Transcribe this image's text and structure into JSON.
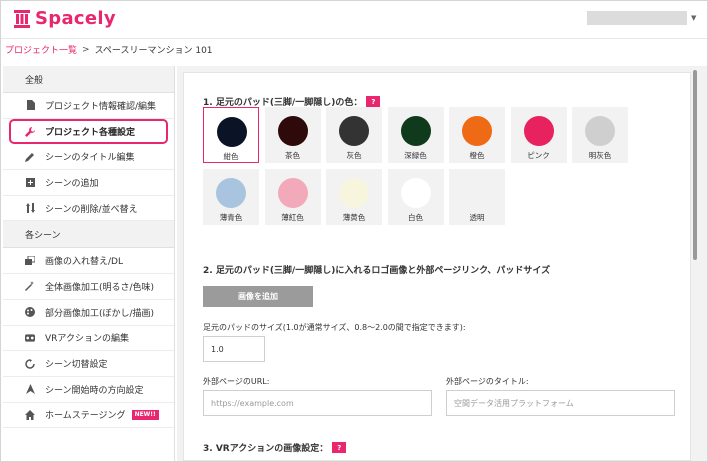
{
  "brand": {
    "name": "Spacely",
    "accent": "#e8276f"
  },
  "breadcrumb": {
    "link": "プロジェクト一覧",
    "separator": ">",
    "current": "スペースリーマンション 101"
  },
  "sidebar": {
    "section_general": "全般",
    "general_items": [
      {
        "label": "プロジェクト情報確認/編集",
        "icon": "document-icon"
      },
      {
        "label": "プロジェクト各種設定",
        "icon": "wrench-icon",
        "active": true
      },
      {
        "label": "シーンのタイトル編集",
        "icon": "pencil-icon"
      },
      {
        "label": "シーンの追加",
        "icon": "plus-square-icon"
      },
      {
        "label": "シーンの削除/並べ替え",
        "icon": "sort-icon"
      }
    ],
    "section_scenes": "各シーン",
    "scene_items": [
      {
        "label": "画像の入れ替え/DL",
        "icon": "image-swap-icon"
      },
      {
        "label": "全体画像加工(明るさ/色味)",
        "icon": "magic-wand-icon"
      },
      {
        "label": "部分画像加工(ぼかし/描画)",
        "icon": "palette-icon"
      },
      {
        "label": "VRアクションの編集",
        "icon": "vr-icon"
      },
      {
        "label": "シーン切替設定",
        "icon": "refresh-icon"
      },
      {
        "label": "シーン開始時の方向設定",
        "icon": "direction-icon"
      },
      {
        "label": "ホームステージング",
        "icon": "home-icon",
        "badge": "NEW!!"
      }
    ]
  },
  "section1": {
    "title": "1. 足元のパッド(三脚/一脚隠し)の色：",
    "help": "?",
    "colors": [
      {
        "label": "紺色",
        "hex": "#0b1426",
        "selected": true
      },
      {
        "label": "茶色",
        "hex": "#2e0a0a"
      },
      {
        "label": "灰色",
        "hex": "#333333"
      },
      {
        "label": "深緑色",
        "hex": "#0f3a1c"
      },
      {
        "label": "橙色",
        "hex": "#ee6a14"
      },
      {
        "label": "ピンク",
        "hex": "#e8215f"
      },
      {
        "label": "明灰色",
        "hex": "#cfcfcf"
      },
      {
        "label": "薄青色",
        "hex": "#a9c4df"
      },
      {
        "label": "薄紅色",
        "hex": "#f2a9ba"
      },
      {
        "label": "薄黄色",
        "hex": "#f8f5df"
      },
      {
        "label": "白色",
        "hex": "#ffffff"
      },
      {
        "label": "透明",
        "hex": "transparent"
      }
    ]
  },
  "section2": {
    "title": "2. 足元のパッド(三脚/一脚隠し)に入れるロゴ画像と外部ページリンク、パッドサイズ",
    "add_image_button": "画像を追加",
    "size_label": "足元のパッドのサイズ(1.0が通常サイズ、0.8〜2.0の間で指定できます):",
    "size_value": "1.0",
    "url_label": "外部ページのURL:",
    "url_placeholder": "https://example.com",
    "page_title_label": "外部ページのタイトル:",
    "page_title_placeholder": "空間データ活用プラットフォーム"
  },
  "section3": {
    "title": "3. VRアクションの画像設定：",
    "help": "?"
  }
}
